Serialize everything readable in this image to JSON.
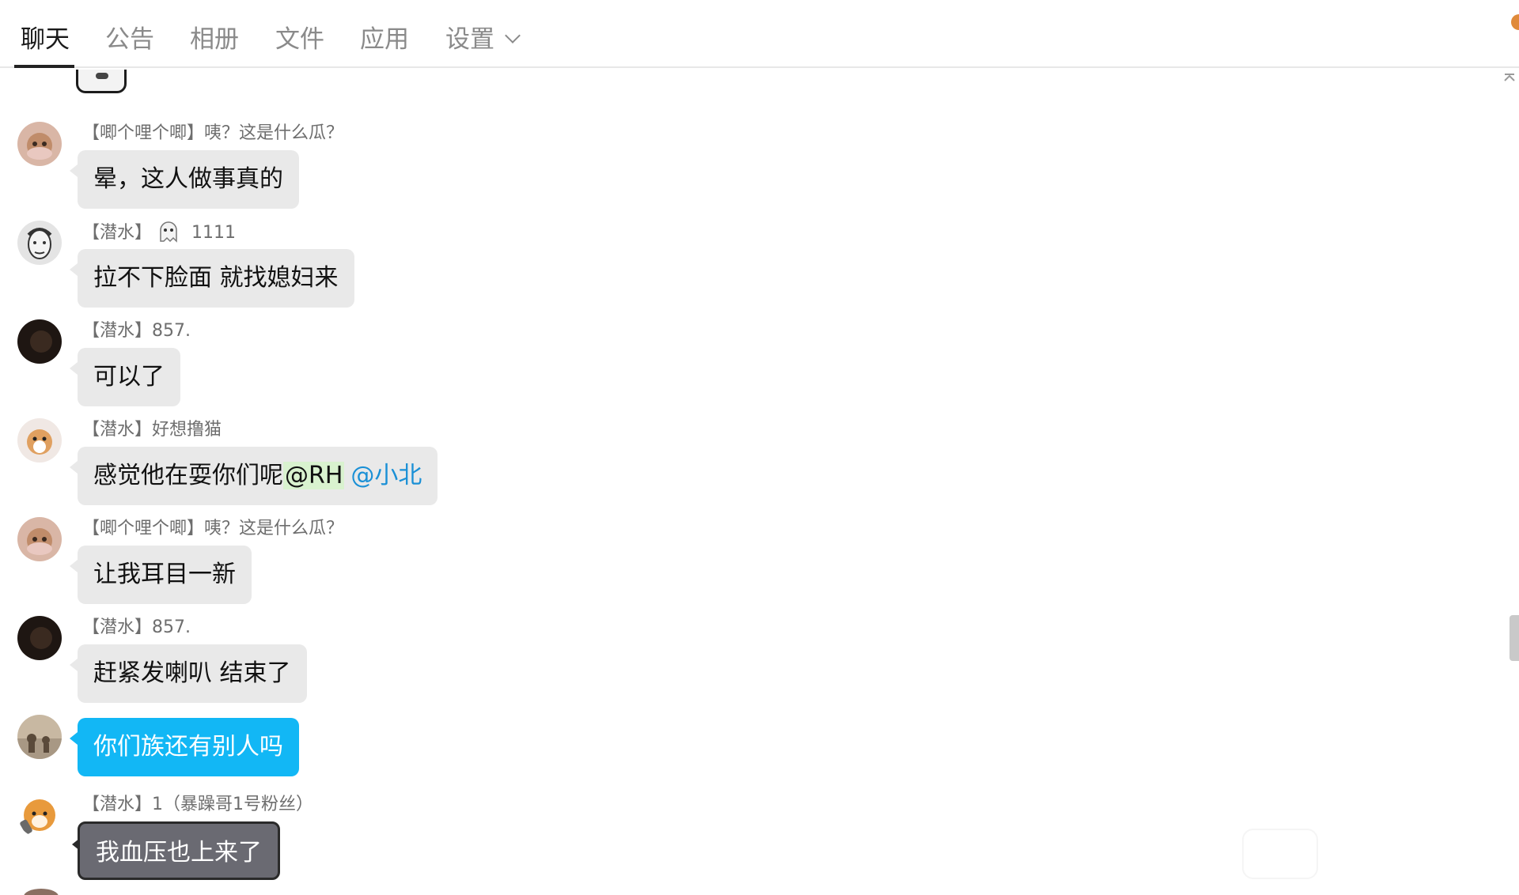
{
  "tabs": [
    {
      "label": "聊天",
      "active": true
    },
    {
      "label": "公告",
      "active": false
    },
    {
      "label": "相册",
      "active": false
    },
    {
      "label": "文件",
      "active": false
    },
    {
      "label": "应用",
      "active": false
    },
    {
      "label": "设置",
      "active": false,
      "has_dropdown": true
    }
  ],
  "messages": [
    {
      "sender": "【唧个哩个唧】咦？这是什么瓜？",
      "text": "晕，这人做事真的",
      "avatar": "cat-avatar"
    },
    {
      "sender_tag": "【潜水】",
      "sender_name": "1111",
      "sender_icon": "ghost-icon",
      "text": "拉不下脸面 就找媳妇来",
      "avatar": "sketch-face-avatar"
    },
    {
      "sender": "【潜水】857.",
      "text": "可以了",
      "avatar": "dark-avatar"
    },
    {
      "sender": "【潜水】好想撸猫",
      "text_main": "感觉他在耍你们呢",
      "mention_highlight": "@RH",
      "mention_link": "@小北",
      "avatar": "pomeranian-avatar"
    },
    {
      "sender": "【唧个哩个唧】咦？这是什么瓜？",
      "text": "让我耳目一新",
      "avatar": "cat-avatar"
    },
    {
      "sender": "【潜水】857.",
      "text": "赶紧发喇叭 结束了",
      "avatar": "dark-avatar"
    },
    {
      "sender": "",
      "text": "你们族还有别人吗",
      "avatar": "silhouette-avatar",
      "self": true
    },
    {
      "sender": "【潜水】1（暴躁哥1号粉丝）",
      "text": "我血压也上来了",
      "avatar": "shiba-avatar"
    }
  ],
  "colors": {
    "self_bubble": "#12b7f5",
    "other_bubble": "#e9e9e9",
    "mention_link": "#1a90d6",
    "mention_highlight": "#d9f2cf"
  }
}
